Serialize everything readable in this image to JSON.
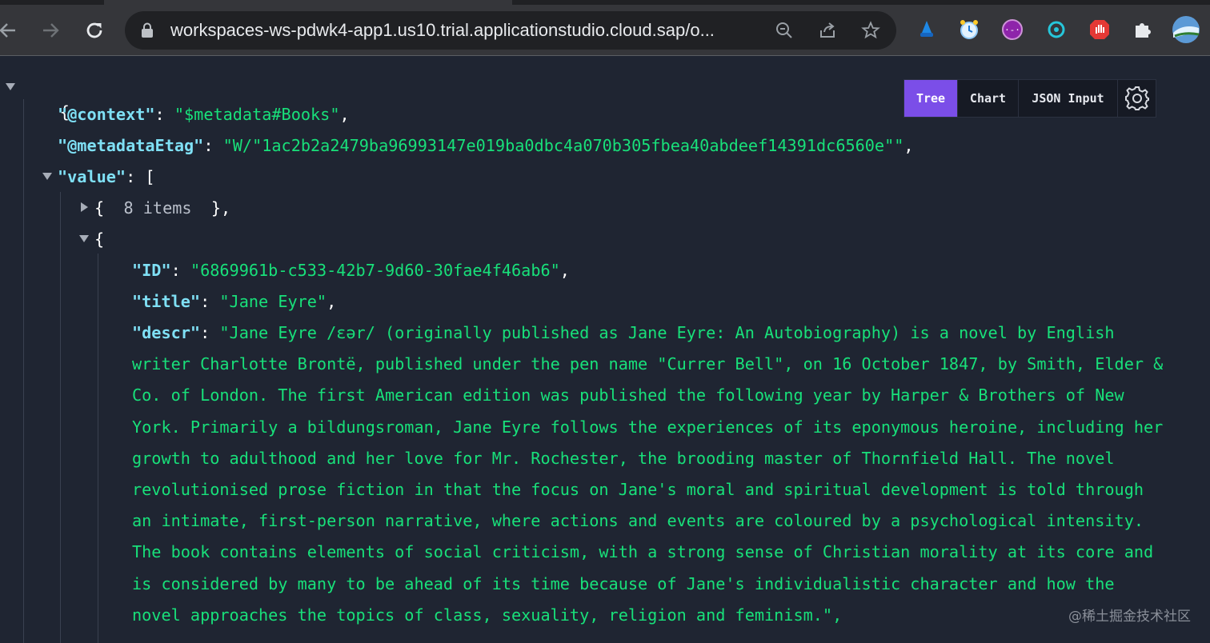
{
  "browser": {
    "url": "workspaces-ws-pdwk4-app1.us10.trial.applicationstudio.cloud.sap/o...",
    "extensions": [
      "wizard-extension-icon",
      "alarm-clock-extension-icon",
      "purple-code-extension-icon",
      "teal-circle-extension-icon",
      "red-hand-extension-icon",
      "puzzle-extensions-icon",
      "profile-avatar"
    ]
  },
  "toolbar": {
    "tree_label": "Tree",
    "chart_label": "Chart",
    "json_input_label": "JSON Input",
    "active_tab": "Tree"
  },
  "json": {
    "root_open": "{",
    "context_key": "\"@context\"",
    "context_value": "\"$metadata#Books\"",
    "etag_key": "\"@metadataEtag\"",
    "etag_value": "\"W/\"1ac2b2a2479ba96993147e019ba0dbc4a070b305fbea40abdeef14391dc6560e\"\"",
    "value_key": "\"value\"",
    "value_open": "[",
    "collapsed_open": "{",
    "collapsed_count": "8 items",
    "collapsed_close": "},",
    "item_open": "{",
    "id_key": "\"ID\"",
    "id_value": "\"6869961b-c533-42b7-9d60-30fae4f46ab6\"",
    "title_key": "\"title\"",
    "title_value": "\"Jane Eyre\"",
    "descr_key": "\"descr\"",
    "descr_lines": [
      "\"Jane Eyre /ɛər/ (originally published as Jane Eyre: An Autobiography) is a novel by English",
      "writer Charlotte Brontë, published under the pen name \"Currer Bell\", on 16 October 1847, by Smith, Elder &",
      "Co. of London. The first American edition was published the following year by Harper & Brothers of New",
      "York. Primarily a bildungsroman, Jane Eyre follows the experiences of its eponymous heroine, including her",
      "growth to adulthood and her love for Mr. Rochester, the brooding master of Thornfield Hall. The novel",
      "revolutionised prose fiction in that the focus on Jane's moral and spiritual development is told through",
      "an intimate, first-person narrative, where actions and events are coloured by a psychological intensity.",
      "The book contains elements of social criticism, with a strong sense of Christian morality at its core and",
      "is considered by many to be ahead of its time because of Jane's individualistic character and how the",
      "novel approaches the topics of class, sexuality, religion and feminism.\","
    ]
  },
  "watermark": "@稀土掘金技术社区",
  "colors": {
    "background": "#1f2532",
    "key": "#7fe0f5",
    "string": "#18e07a",
    "active_tab": "#7b4ee8"
  }
}
